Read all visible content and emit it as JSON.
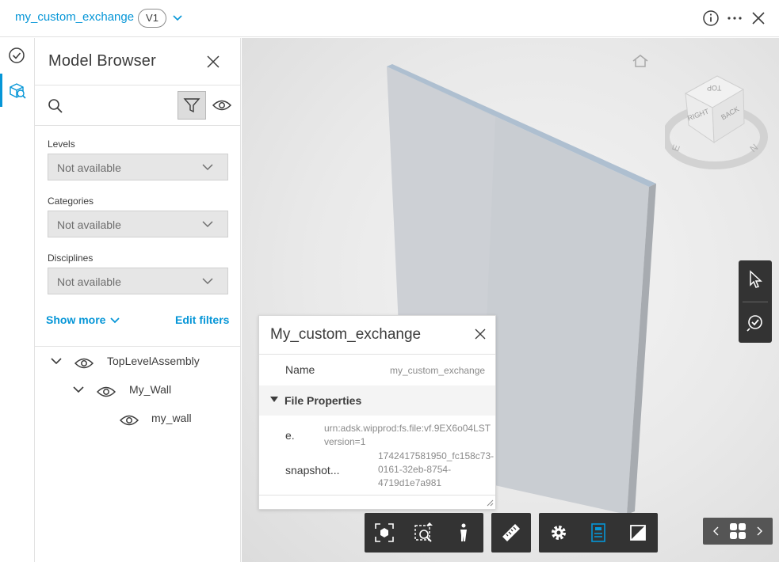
{
  "topbar": {
    "title": "my_custom_exchange",
    "version": "V1"
  },
  "model_browser": {
    "title": "Model Browser",
    "filters": [
      {
        "label": "Levels",
        "value": "Not available"
      },
      {
        "label": "Categories",
        "value": "Not available"
      },
      {
        "label": "Disciplines",
        "value": "Not available"
      }
    ],
    "show_more": "Show more",
    "edit_filters": "Edit filters",
    "tree": [
      {
        "label": "TopLevelAssembly"
      },
      {
        "label": "My_Wall"
      },
      {
        "label": "my_wall"
      }
    ]
  },
  "viewcube": {
    "top": "TOP",
    "right": "RIGHT",
    "back": "BACK",
    "east": "E",
    "north": "N"
  },
  "properties": {
    "title": "My_custom_exchange",
    "name_label": "Name",
    "name_value": "my_custom_exchange",
    "section": "File Properties",
    "rows": [
      {
        "name": "e.",
        "value_line1": "urn:adsk.wipprod:fs.file:vf.9EX6o04LST",
        "value_line2": "version=1"
      },
      {
        "name": "snapshot...",
        "value_line1": "1742417581950_fc158c73-",
        "value_line2": "0161-32eb-8754-",
        "value_line3": "4719d1e7a981"
      }
    ]
  },
  "colors": {
    "accent": "#0696d7",
    "toolbar": "#333333",
    "wall": "#c2c7cd"
  }
}
